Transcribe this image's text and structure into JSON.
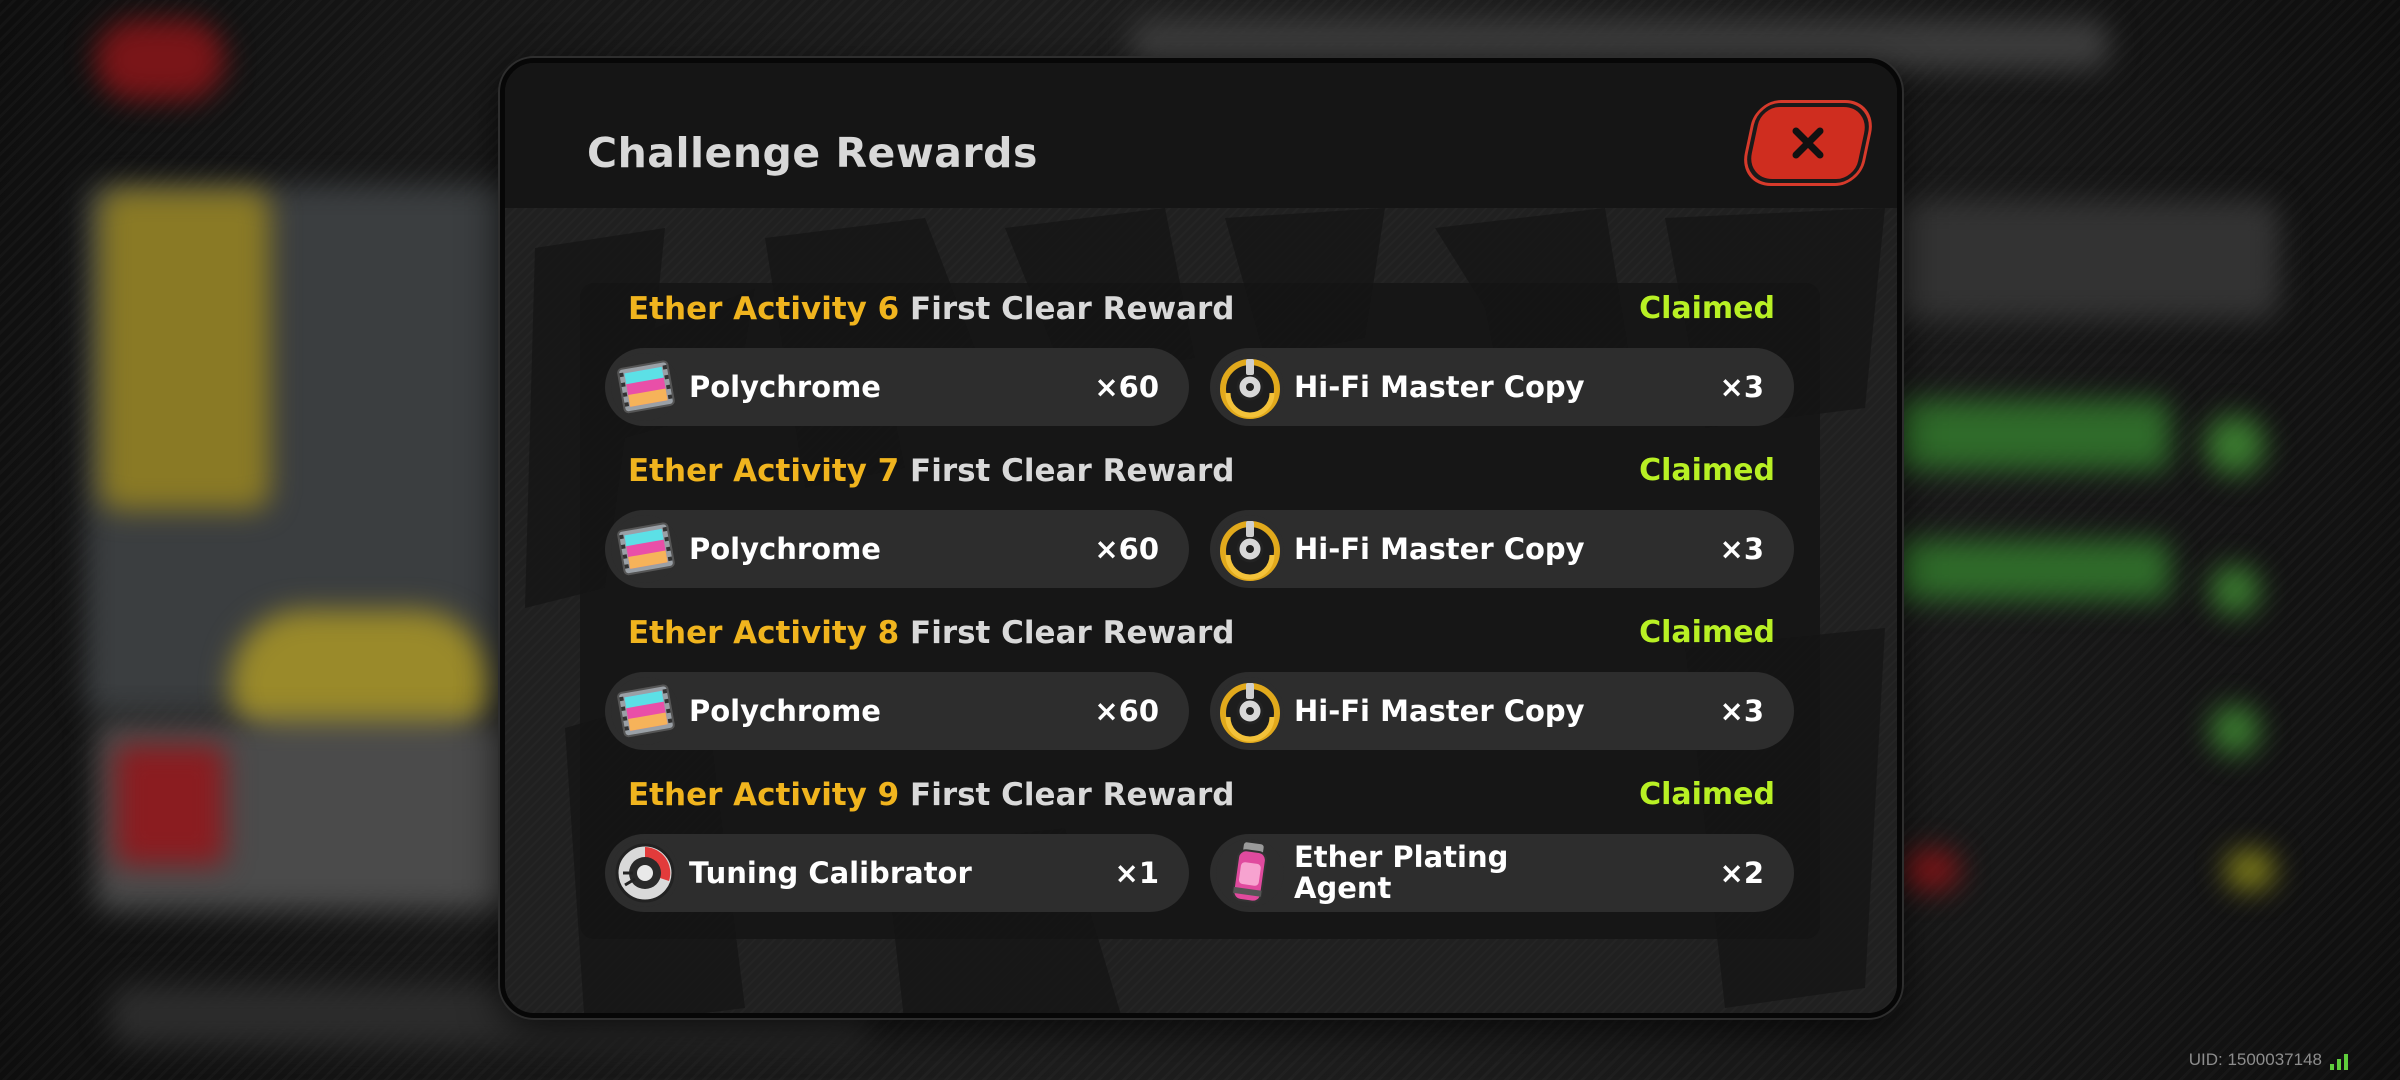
{
  "dialog": {
    "title": "Challenge Rewards",
    "close_icon": "close-x-icon"
  },
  "sections": [
    {
      "activity": "Ether Activity 6",
      "suffix": "First Clear Reward",
      "status": "Claimed",
      "rewards": [
        {
          "name": "Polychrome",
          "qty": "×60",
          "icon": "polychrome-film-icon"
        },
        {
          "name": "Hi-Fi Master Copy",
          "qty": "×3",
          "icon": "hifi-master-copy-disc-icon"
        }
      ]
    },
    {
      "activity": "Ether Activity 7",
      "suffix": "First Clear Reward",
      "status": "Claimed",
      "rewards": [
        {
          "name": "Polychrome",
          "qty": "×60",
          "icon": "polychrome-film-icon"
        },
        {
          "name": "Hi-Fi Master Copy",
          "qty": "×3",
          "icon": "hifi-master-copy-disc-icon"
        }
      ]
    },
    {
      "activity": "Ether Activity 8",
      "suffix": "First Clear Reward",
      "status": "Claimed",
      "rewards": [
        {
          "name": "Polychrome",
          "qty": "×60",
          "icon": "polychrome-film-icon"
        },
        {
          "name": "Hi-Fi Master Copy",
          "qty": "×3",
          "icon": "hifi-master-copy-disc-icon"
        }
      ]
    },
    {
      "activity": "Ether Activity 9",
      "suffix": "First Clear Reward",
      "status": "Claimed",
      "rewards": [
        {
          "name": "Tuning Calibrator",
          "qty": "×1",
          "icon": "tuning-calibrator-icon"
        },
        {
          "name": "Ether Plating Agent",
          "qty": "×2",
          "icon": "ether-plating-agent-canister-icon"
        }
      ]
    }
  ],
  "footer": {
    "uid": "UID: 1500037148"
  },
  "colors": {
    "accent_yellow": "#f0b41e",
    "claimed_green": "#b8f024",
    "close_red": "#cf2d1f"
  }
}
